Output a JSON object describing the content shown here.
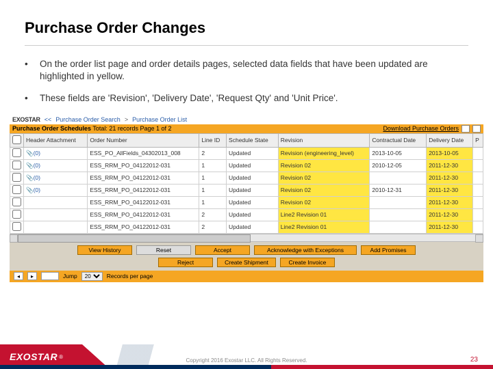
{
  "title": "Purchase Order Changes",
  "bullets": [
    "On the order list page and order details pages, selected data fields that have been updated are highlighted in yellow.",
    "These fields are 'Revision', 'Delivery Date', 'Request Qty' and 'Unit Price'."
  ],
  "breadcrumb": {
    "logo": "EXOSTAR",
    "back": "<<",
    "items": [
      "Purchase Order Search",
      "Purchase Order List"
    ]
  },
  "schedules": {
    "label": "Purchase Order Schedules",
    "summary": "Total: 21 records Page 1 of 2",
    "download": "Download Purchase Orders"
  },
  "table": {
    "headers": [
      "",
      "Header Attachment",
      "Order Number",
      "Line ID",
      "Schedule State",
      "Revision",
      "Contractual Date",
      "Delivery Date",
      "P"
    ],
    "rows": [
      {
        "cb": true,
        "attach": "📎(0)",
        "order": "ESS_PO_AllFields_04302013_008",
        "line": "2",
        "state": "Updated",
        "rev": "Revision (engineering_level)",
        "revHL": true,
        "cdate": "2013-10-05",
        "ddate": "2013-10-05",
        "ddHL": true
      },
      {
        "cb": true,
        "attach": "📎(0)",
        "order": "ESS_RRM_PO_04122012-031",
        "line": "1",
        "state": "Updated",
        "rev": "Revision 02",
        "revHL": true,
        "cdate": "2010-12-05",
        "ddate": "2011-12-30",
        "ddHL": true
      },
      {
        "cb": true,
        "attach": "📎(0)",
        "order": "ESS_RRM_PO_04122012-031",
        "line": "1",
        "state": "Updated",
        "rev": "Revision 02",
        "revHL": true,
        "cdate": "",
        "ddate": "2011-12-30",
        "ddHL": true
      },
      {
        "cb": true,
        "attach": "📎(0)",
        "order": "ESS_RRM_PO_04122012-031",
        "line": "1",
        "state": "Updated",
        "rev": "Revision 02",
        "revHL": true,
        "cdate": "2010-12-31",
        "ddate": "2011-12-30",
        "ddHL": true
      },
      {
        "cb": true,
        "attach": "",
        "order": "ESS_RRM_PO_04122012-031",
        "line": "1",
        "state": "Updated",
        "rev": "Revision 02",
        "revHL": true,
        "cdate": "",
        "ddate": "2011-12-30",
        "ddHL": true
      },
      {
        "cb": true,
        "attach": "",
        "order": "ESS_RRM_PO_04122012-031",
        "line": "2",
        "state": "Updated",
        "rev": "Line2 Revision 01",
        "revHL": true,
        "cdate": "",
        "ddate": "2011-12-30",
        "ddHL": true
      },
      {
        "cb": true,
        "attach": "",
        "order": "ESS_RRM_PO_04122012-031",
        "line": "2",
        "state": "Updated",
        "rev": "Line2 Revision 01",
        "revHL": true,
        "cdate": "",
        "ddate": "2011-12-30",
        "ddHL": true
      }
    ]
  },
  "actions": {
    "row1": [
      "View History",
      "Reset",
      "Accept",
      "Acknowledge with Exceptions",
      "Add Promises"
    ],
    "row2": [
      "Reject",
      "Create Shipment",
      "Create Invoice"
    ]
  },
  "pager": {
    "jump_label": "Jump",
    "jump_value": "",
    "perpage_value": "20",
    "perpage_label": "Records per page"
  },
  "footer": {
    "brand": "EXOSTAR",
    "copyright": "Copyright 2016 Exostar LLC. All Rights Reserved.",
    "pagenum": "23"
  }
}
